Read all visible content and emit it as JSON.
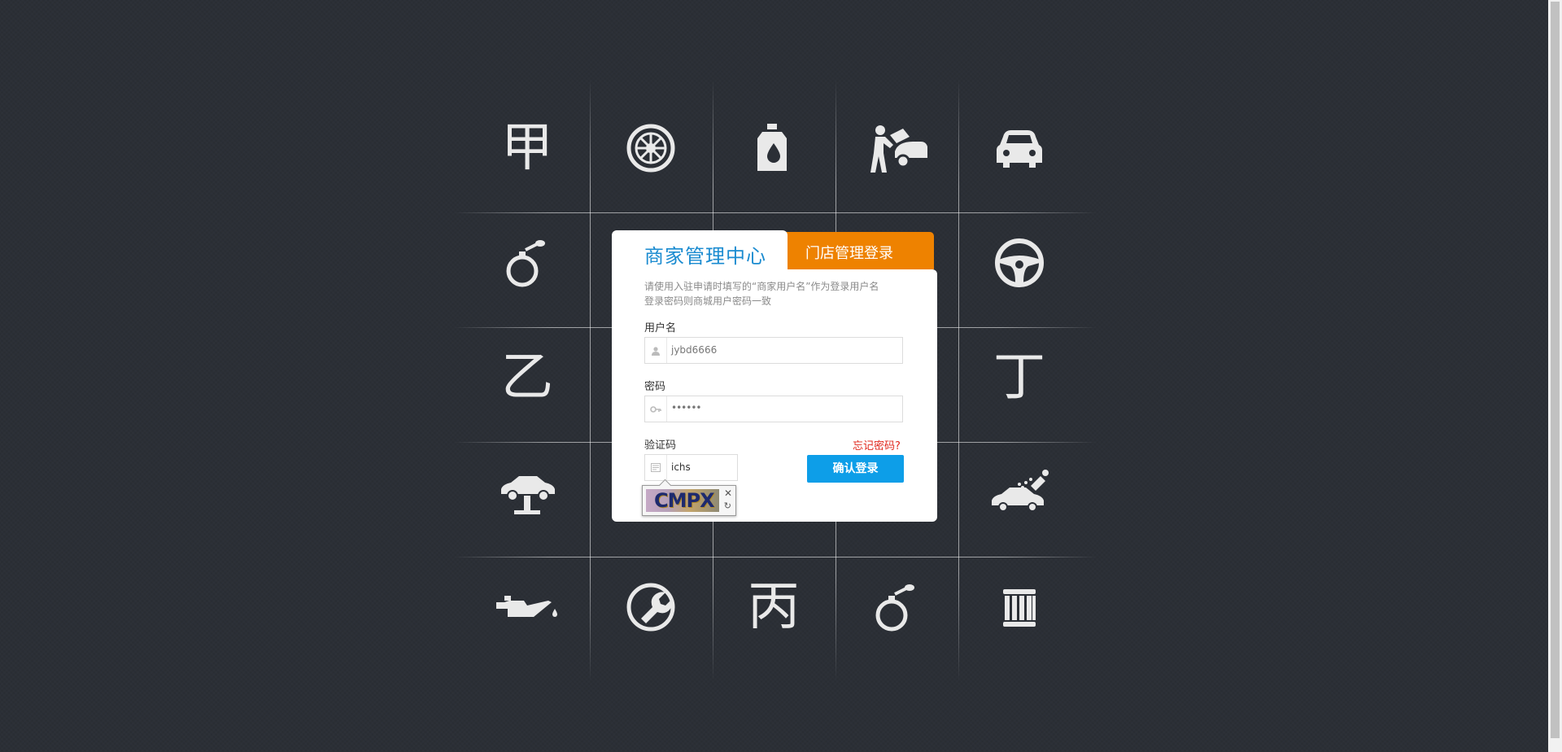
{
  "colors": {
    "background": "#2b2f36",
    "accent_blue": "#1a8bd0",
    "accent_orange": "#ee8200",
    "button_blue": "#0d9ee8",
    "forgot_red": "#e0291e"
  },
  "grid": {
    "cells": [
      {
        "kind": "glyph",
        "glyph": "甲"
      },
      {
        "kind": "icon",
        "icon": "wheel-icon"
      },
      {
        "kind": "icon",
        "icon": "oil-bottle-icon"
      },
      {
        "kind": "icon",
        "icon": "mechanic-icon"
      },
      {
        "kind": "icon",
        "icon": "car-front-icon"
      },
      {
        "kind": "icon",
        "icon": "air-freshener-icon"
      },
      {
        "kind": "icon",
        "icon": "steering-wheel-icon"
      },
      {
        "kind": "glyph",
        "glyph": "乙"
      },
      {
        "kind": "glyph",
        "glyph": "丁"
      },
      {
        "kind": "icon",
        "icon": "car-lift-icon"
      },
      {
        "kind": "icon",
        "icon": "car-wash-icon"
      },
      {
        "kind": "icon",
        "icon": "oil-can-icon"
      },
      {
        "kind": "icon",
        "icon": "wrench-circle-icon"
      },
      {
        "kind": "glyph",
        "glyph": "丙"
      },
      {
        "kind": "icon",
        "icon": "air-freshener-icon"
      },
      {
        "kind": "icon",
        "icon": "air-filter-icon"
      }
    ]
  },
  "login": {
    "tab_active": "商家管理中心",
    "tab_inactive": "门店管理登录",
    "hint_line1": "请使用入驻申请时填写的“商家用户名”作为登录用户名",
    "hint_line2": "登录密码则商城用户密码一致",
    "username_label": "用户名",
    "username_value": "jybd6666",
    "password_label": "密码",
    "password_value": "••••••",
    "captcha_label": "验证码",
    "forgot_label": "忘记密码?",
    "captcha_value": "ichs",
    "captcha_code": "CMPX",
    "captcha_close": "✕",
    "captcha_refresh": "↻",
    "submit_label": "确认登录"
  }
}
